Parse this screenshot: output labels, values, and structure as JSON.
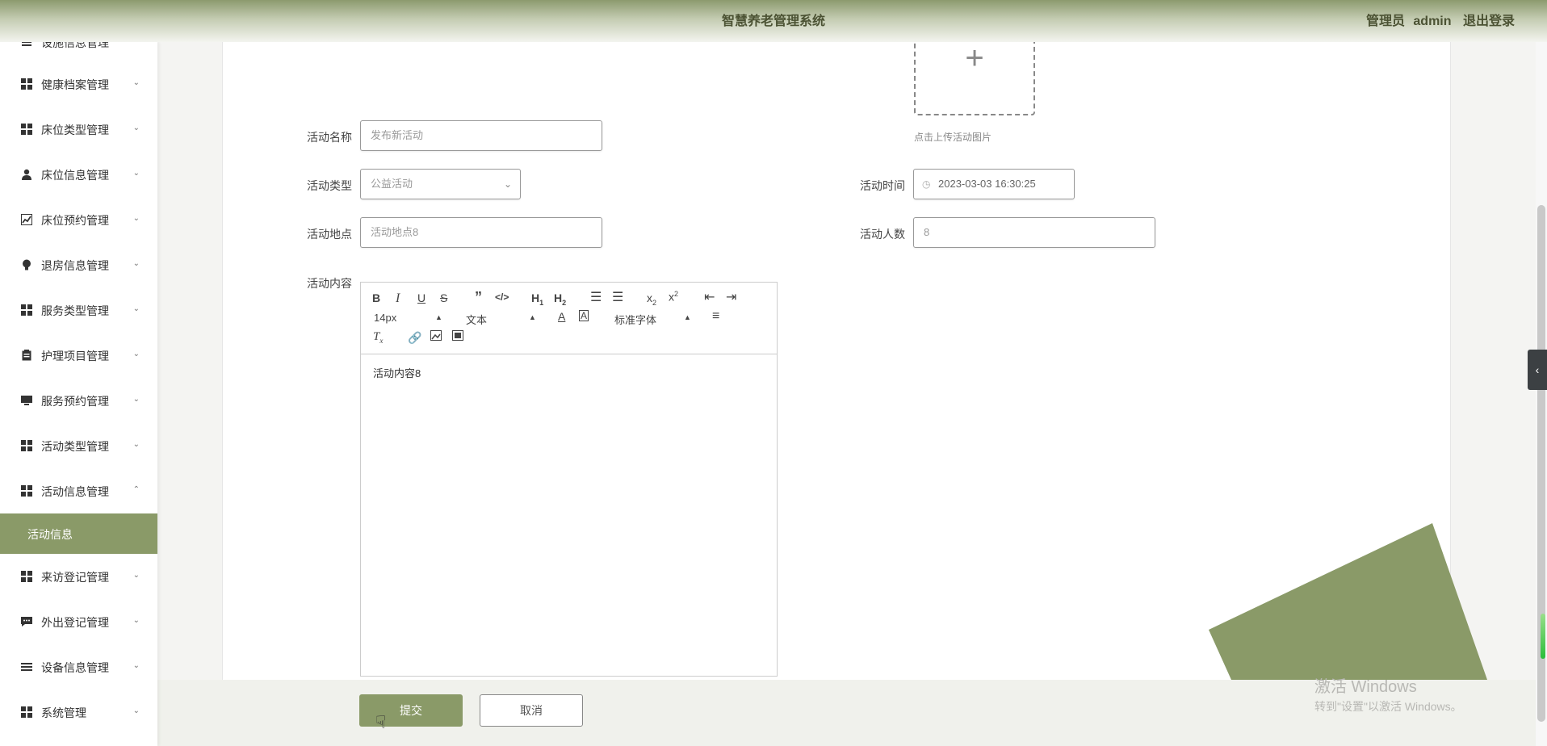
{
  "header": {
    "title": "智慧养老管理系统",
    "role": "管理员",
    "username": "admin",
    "logout": "退出登录"
  },
  "sidebar": {
    "cut_item": "设施信息管理",
    "items": [
      {
        "label": "健康档案管理",
        "icon": "grid-icon"
      },
      {
        "label": "床位类型管理",
        "icon": "grid-icon"
      },
      {
        "label": "床位信息管理",
        "icon": "user-icon"
      },
      {
        "label": "床位预约管理",
        "icon": "chart-icon"
      },
      {
        "label": "退房信息管理",
        "icon": "bulb-icon"
      },
      {
        "label": "服务类型管理",
        "icon": "grid-icon"
      },
      {
        "label": "护理项目管理",
        "icon": "clipboard-icon"
      },
      {
        "label": "服务预约管理",
        "icon": "monitor-icon"
      },
      {
        "label": "活动类型管理",
        "icon": "grid-icon"
      },
      {
        "label": "活动信息管理",
        "icon": "grid-icon"
      },
      {
        "label": "来访登记管理",
        "icon": "grid-icon"
      },
      {
        "label": "外出登记管理",
        "icon": "chat-icon"
      },
      {
        "label": "设备信息管理",
        "icon": "list-icon"
      },
      {
        "label": "系统管理",
        "icon": "grid-icon"
      }
    ],
    "active_sub": "活动信息"
  },
  "form": {
    "name_label": "活动名称",
    "name_placeholder": "发布新活动",
    "type_label": "活动类型",
    "type_value": "公益活动",
    "time_label": "活动时间",
    "time_value": "2023-03-03 16:30:25",
    "place_label": "活动地点",
    "place_value": "活动地点8",
    "people_label": "活动人数",
    "people_value": "8",
    "content_label": "活动内容",
    "upload_tip": "点击上传活动图片"
  },
  "editor": {
    "font_size": "14px",
    "paragraph": "文本",
    "font_family": "标准字体",
    "content": "活动内容8"
  },
  "buttons": {
    "submit": "提交",
    "cancel": "取消"
  },
  "watermark": {
    "line1": "激活 Windows",
    "line2": "转到\"设置\"以激活 Windows。"
  },
  "colors": {
    "accent": "#8a9a68",
    "header_text": "#4b5233"
  }
}
